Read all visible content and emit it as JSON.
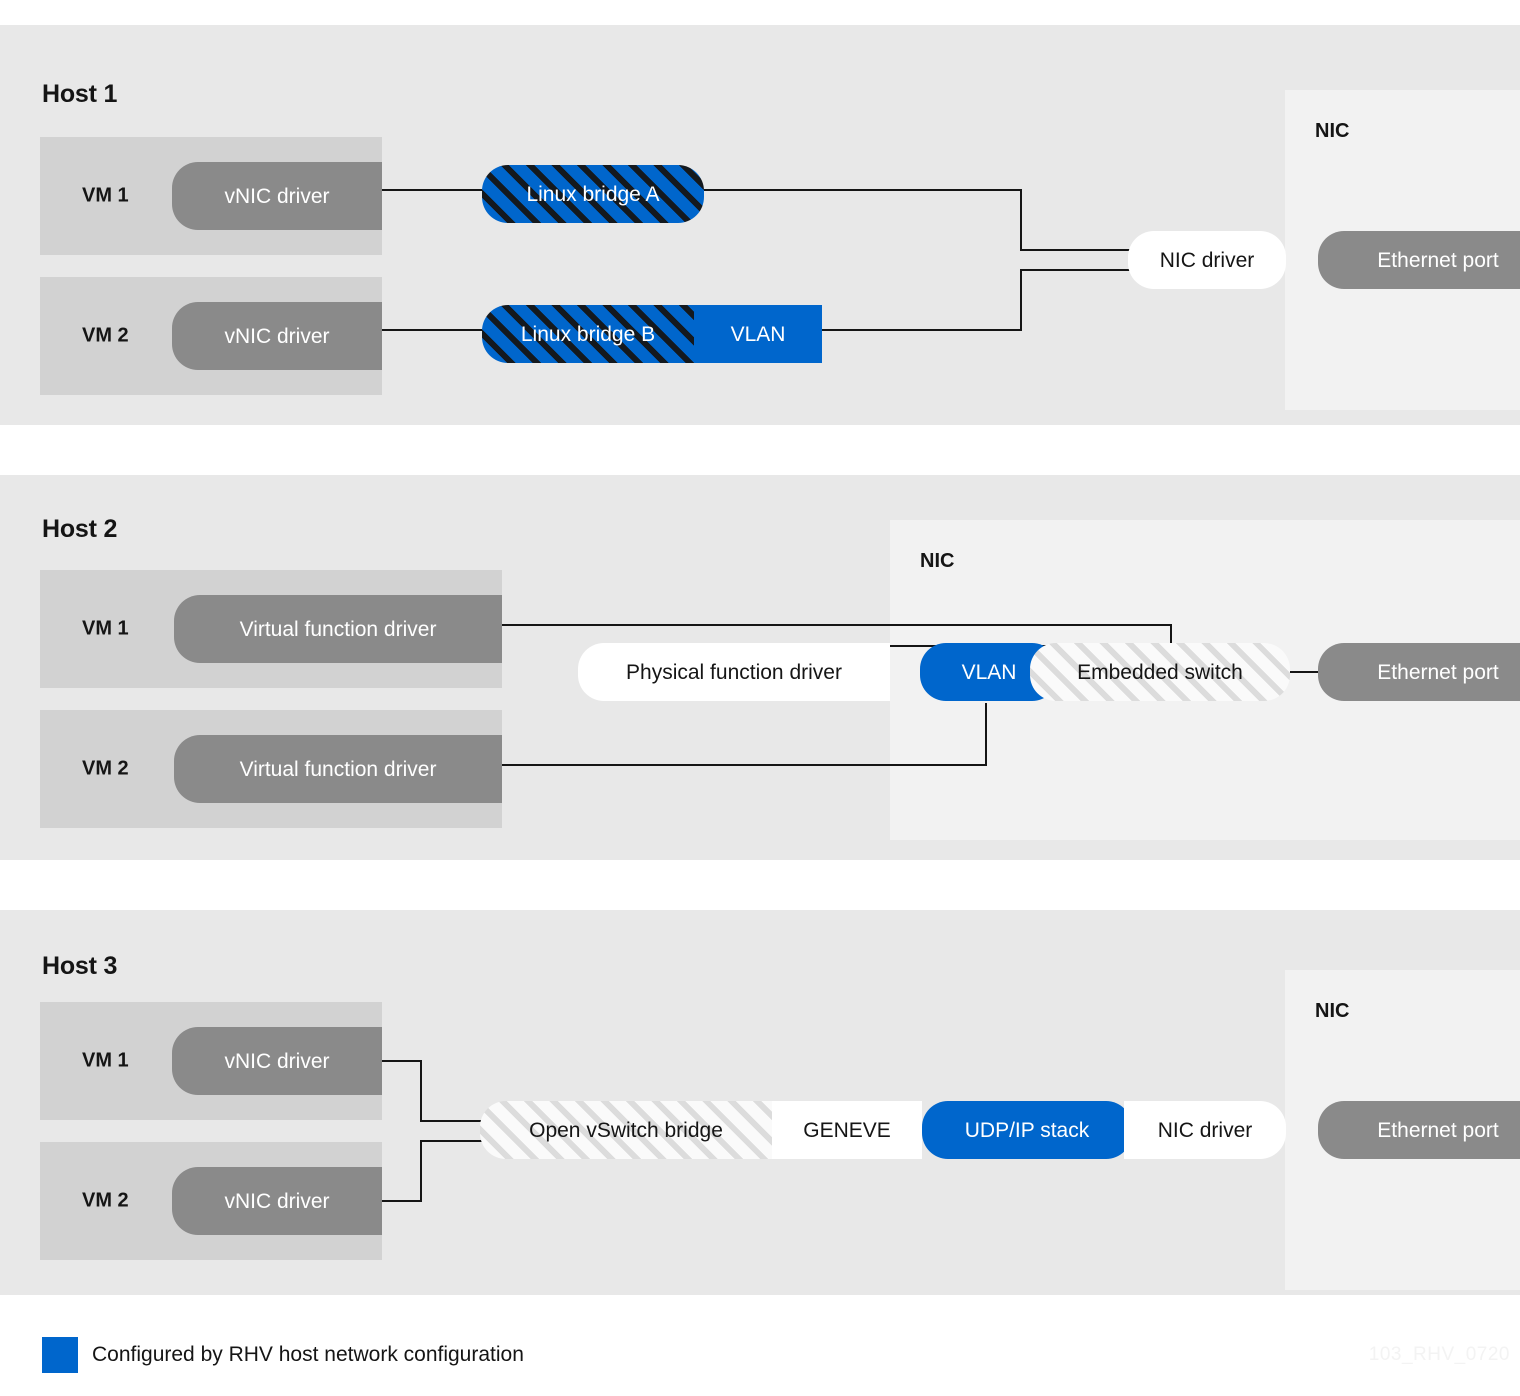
{
  "hosts": [
    {
      "title": "Host 1",
      "vms": [
        {
          "label": "VM 1",
          "driver": "vNIC driver"
        },
        {
          "label": "VM 2",
          "driver": "vNIC driver"
        }
      ],
      "nodes": {
        "bridge_a": "Linux bridge A",
        "bridge_b": "Linux bridge B",
        "vlan": "VLAN",
        "nic_driver": "NIC driver"
      },
      "nic": {
        "title": "NIC",
        "port": "Ethernet port"
      }
    },
    {
      "title": "Host 2",
      "vms": [
        {
          "label": "VM 1",
          "driver": "Virtual function driver"
        },
        {
          "label": "VM 2",
          "driver": "Virtual function driver"
        }
      ],
      "nodes": {
        "pf_driver": "Physical function driver",
        "vlan": "VLAN",
        "embedded_switch": "Embedded switch"
      },
      "nic": {
        "title": "NIC",
        "port": "Ethernet port"
      }
    },
    {
      "title": "Host 3",
      "vms": [
        {
          "label": "VM 1",
          "driver": "vNIC driver"
        },
        {
          "label": "VM 2",
          "driver": "vNIC driver"
        }
      ],
      "nodes": {
        "ovs_bridge": "Open vSwitch bridge",
        "geneve": "GENEVE",
        "udp_ip_stack": "UDP/IP stack",
        "nic_driver": "NIC driver"
      },
      "nic": {
        "title": "NIC",
        "port": "Ethernet port"
      }
    }
  ],
  "legend": {
    "label": "Configured by RHV host network configuration",
    "color": "#0066cc"
  },
  "watermark": "103_RHV_0720",
  "colors": {
    "accent_blue": "#0066cc",
    "panel_bg": "#e8e8e8",
    "vm_bg": "#d2d2d2",
    "pill_grey": "#8a8a8a",
    "nic_bg": "#f2f2f2",
    "line": "#151515"
  }
}
